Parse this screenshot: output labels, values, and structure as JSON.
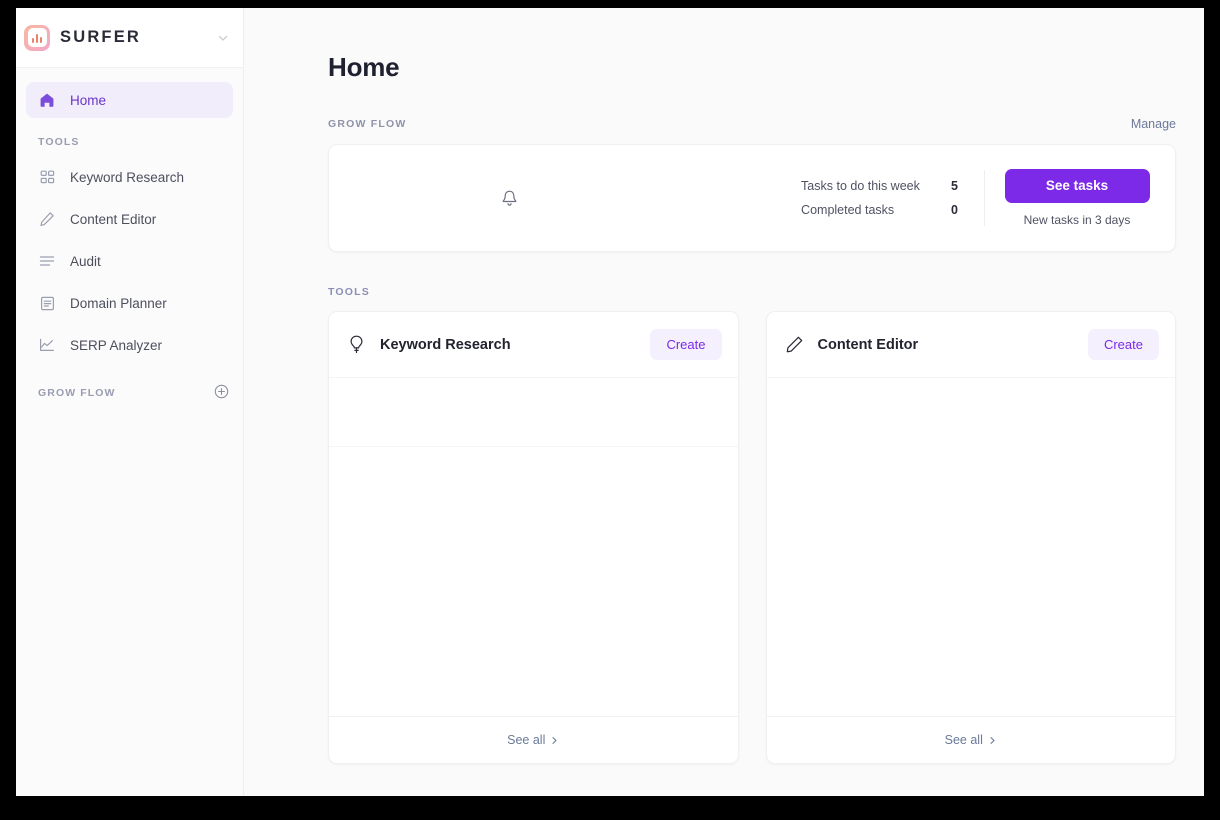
{
  "brand": {
    "name": "SURFER",
    "chevron_icon": "chevron-down-icon"
  },
  "sidebar": {
    "home": {
      "label": "Home",
      "icon": "home-icon"
    },
    "tools_label": "TOOLS",
    "tools": [
      {
        "label": "Keyword Research",
        "icon": "grid-icon"
      },
      {
        "label": "Content Editor",
        "icon": "pencil-icon"
      },
      {
        "label": "Audit",
        "icon": "list-lines-icon"
      },
      {
        "label": "Domain Planner",
        "icon": "document-icon"
      },
      {
        "label": "SERP Analyzer",
        "icon": "chart-line-icon"
      }
    ],
    "grow_flow_label": "GROW FLOW",
    "grow_flow_add_icon": "plus-circle-icon"
  },
  "main": {
    "title": "Home",
    "grow_flow": {
      "eyebrow": "GROW FLOW",
      "manage_link": "Manage",
      "bell_icon": "bell-icon",
      "stats": [
        {
          "label": "Tasks to do this week",
          "value": "5"
        },
        {
          "label": "Completed tasks",
          "value": "0"
        }
      ],
      "button_label": "See tasks",
      "note": "New tasks in 3 days"
    },
    "tools": {
      "eyebrow": "TOOLS",
      "cards": [
        {
          "title": "Keyword Research",
          "icon": "lightbulb-icon",
          "action_label": "Create",
          "footer_label": "See all",
          "footer_icon": "chevron-right-icon"
        },
        {
          "title": "Content Editor",
          "icon": "pencil-icon",
          "action_label": "Create",
          "footer_label": "See all",
          "footer_icon": "chevron-right-icon"
        }
      ]
    }
  },
  "colors": {
    "accent_purple": "#7c2ae8",
    "active_nav_bg": "#f1edfb",
    "link_blue_grey": "#6b7a99",
    "page_bg": "#fafafb"
  }
}
